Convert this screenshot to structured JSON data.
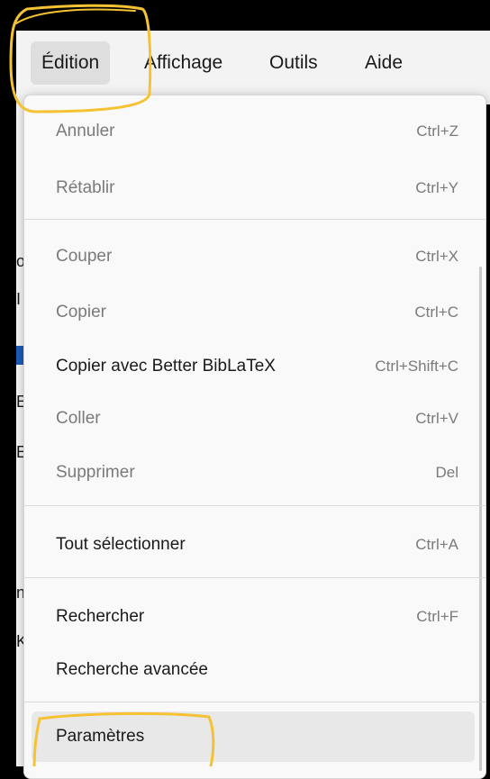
{
  "menubar": {
    "items": [
      {
        "label": "Édition",
        "active": true
      },
      {
        "label": "Affichage",
        "active": false
      },
      {
        "label": "Outils",
        "active": false
      },
      {
        "label": "Aide",
        "active": false
      }
    ]
  },
  "edit_menu": {
    "items": [
      {
        "label": "Annuler",
        "shortcut": "Ctrl+Z",
        "enabled": false
      },
      {
        "label": "Rétablir",
        "shortcut": "Ctrl+Y",
        "enabled": false
      },
      {
        "label": "Couper",
        "shortcut": "Ctrl+X",
        "enabled": false
      },
      {
        "label": "Copier",
        "shortcut": "Ctrl+C",
        "enabled": false
      },
      {
        "label": "Copier avec Better BibLaTeX",
        "shortcut": "Ctrl+Shift+C",
        "enabled": true
      },
      {
        "label": "Coller",
        "shortcut": "Ctrl+V",
        "enabled": false
      },
      {
        "label": "Supprimer",
        "shortcut": "Del",
        "enabled": false
      },
      {
        "label": "Tout sélectionner",
        "shortcut": "Ctrl+A",
        "enabled": true
      },
      {
        "label": "Rechercher",
        "shortcut": "Ctrl+F",
        "enabled": true
      },
      {
        "label": "Recherche avancée",
        "shortcut": "",
        "enabled": true
      },
      {
        "label": "Paramètres",
        "shortcut": "",
        "enabled": true,
        "highlighted": true
      }
    ]
  },
  "colors": {
    "highlight_annotation": "#f5c234",
    "enabled_text": "#1a1a1a",
    "disabled_text": "#7a7a7a",
    "menu_background": "#f9f9f9"
  }
}
